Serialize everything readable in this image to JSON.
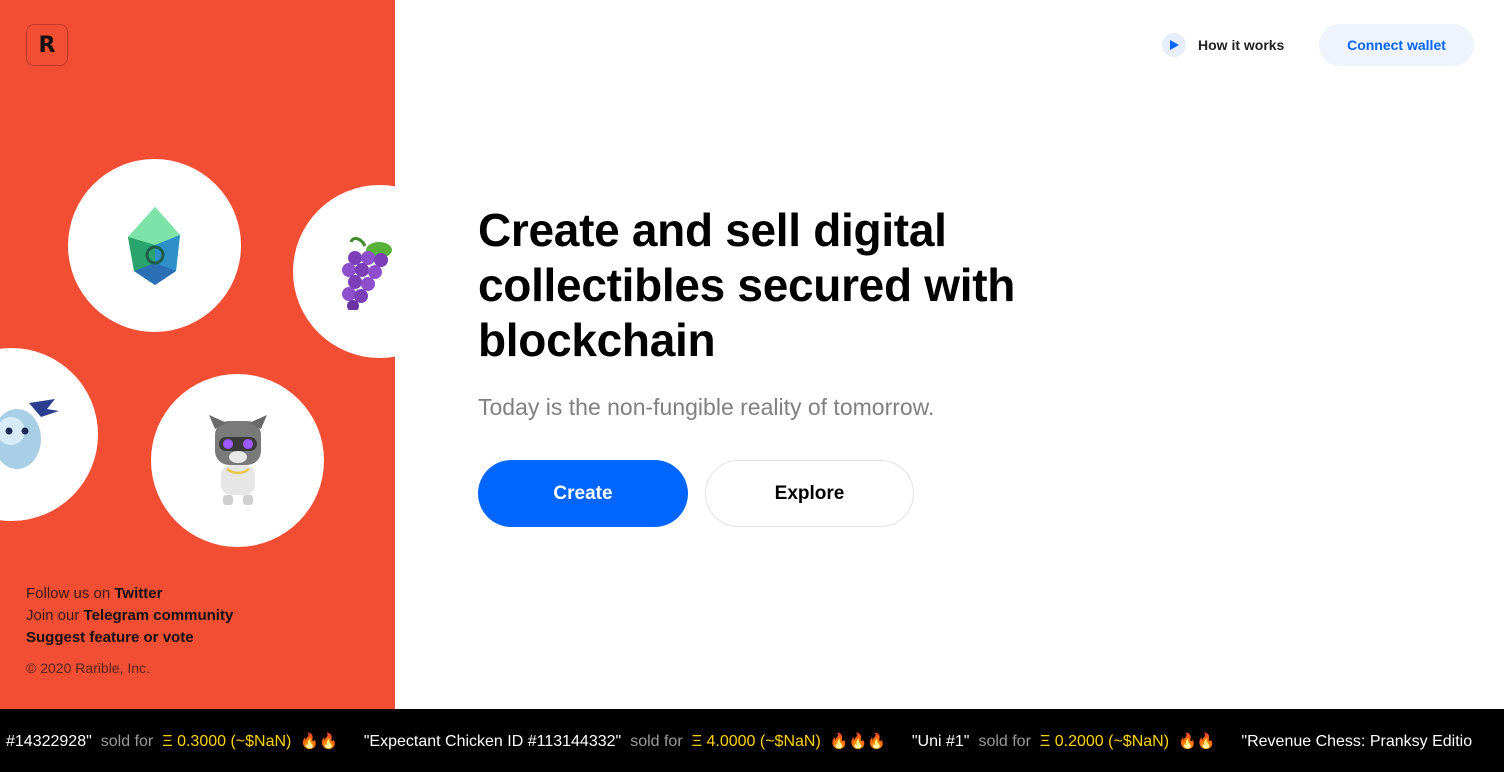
{
  "brand": {
    "logo_letter": "R"
  },
  "header": {
    "how_it_works": "How it works",
    "connect_wallet": "Connect wallet"
  },
  "hero": {
    "title": "Create and sell digital collectibles secured with blockchain",
    "subtitle": "Today is the non-fungible reality of tomorrow.",
    "create_label": "Create",
    "explore_label": "Explore"
  },
  "footer": {
    "twitter_prefix": "Follow us on ",
    "twitter_link": "Twitter",
    "telegram_prefix": "Join our ",
    "telegram_link": "Telegram community",
    "suggest_link": "Suggest feature or vote",
    "copyright": "© 2020 Rarible, Inc."
  },
  "ticker": {
    "sold_for": "sold for",
    "items": [
      {
        "name": "#14322928\"",
        "price": "Ξ 0.3000 (~$NaN)",
        "fire": "🔥🔥"
      },
      {
        "name": "\"Expectant Chicken ID #113144332\"",
        "price": "Ξ 4.0000 (~$NaN)",
        "fire": "🔥🔥🔥"
      },
      {
        "name": "\"Uni #1\"",
        "price": "Ξ 0.2000 (~$NaN)",
        "fire": "🔥🔥"
      },
      {
        "name": "\"Revenue Chess: Pranksy Editio",
        "price": "",
        "fire": ""
      }
    ]
  },
  "colors": {
    "panel_red": "#f24e34",
    "accent_blue": "#0066ff",
    "ticker_yellow": "#ffd400"
  },
  "icons": [
    "play-icon",
    "crystal-gem-icon",
    "grapes-icon",
    "ghost-bat-icon",
    "raccoon-avatar-icon"
  ]
}
